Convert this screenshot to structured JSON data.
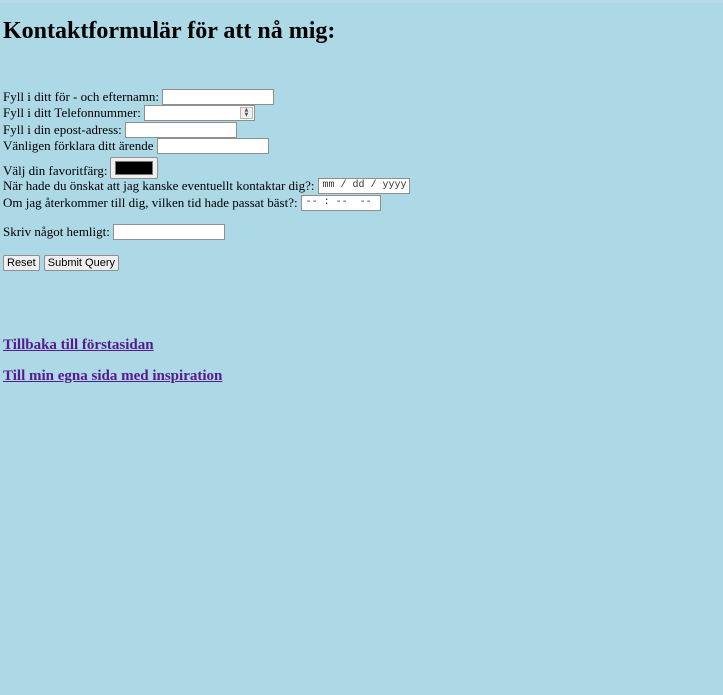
{
  "page": {
    "heading": "Kontaktformulär för att nå mig:",
    "background_color": "#add8e6"
  },
  "form": {
    "name_label": "Fyll i ditt för - och efternamn:",
    "name_value": "",
    "phone_label": "Fyll i ditt Telefonnummer:",
    "phone_value": "",
    "email_label": "Fyll i din epost-adress:",
    "email_value": "",
    "errand_label": "Vänligen förklara ditt ärende",
    "errand_value": "",
    "color_label": "Välj din favoritfärg:",
    "color_value": "#000000",
    "date_label": "När hade du önskat att jag kanske eventuellt kontaktar dig?:",
    "date_placeholder": "mm / dd / yyyy",
    "time_label": "Om jag återkommer till dig, vilken tid hade passat bäst?:",
    "time_placeholder": "-- : --  --",
    "secret_label": "Skriv något hemligt:",
    "secret_value": "",
    "reset_label": "Reset",
    "submit_label": "Submit Query"
  },
  "links": {
    "home": "Tillbaka till förstasidan",
    "inspiration": "Till min egna sida med inspiration",
    "link_color": "#551a8b"
  }
}
